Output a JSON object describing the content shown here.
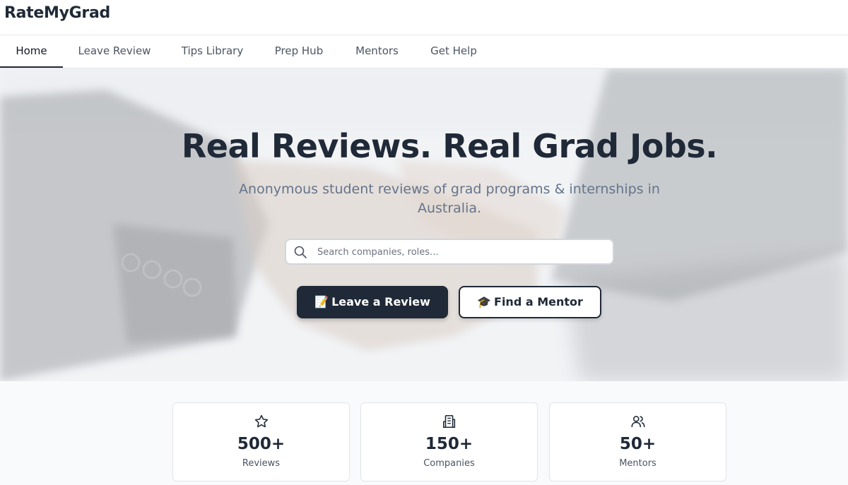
{
  "app": {
    "brand": "RateMyGrad"
  },
  "nav": {
    "tabs": [
      {
        "label": "Home",
        "active": true
      },
      {
        "label": "Leave Review",
        "active": false
      },
      {
        "label": "Tips Library",
        "active": false
      },
      {
        "label": "Prep Hub",
        "active": false
      },
      {
        "label": "Mentors",
        "active": false
      },
      {
        "label": "Get Help",
        "active": false
      }
    ]
  },
  "hero": {
    "title": "Real Reviews. Real Grad Jobs.",
    "subtitle": "Anonymous student reviews of grad programs & internships in Australia.",
    "search": {
      "placeholder": "Search companies, roles...",
      "value": "",
      "icon": "search-icon"
    },
    "primary_button": {
      "emoji": "📝",
      "label": "Leave a Review"
    },
    "secondary_button": {
      "emoji": "🎓",
      "label": "Find a Mentor"
    }
  },
  "stats": [
    {
      "icon": "star-icon",
      "value": "500+",
      "label": "Reviews"
    },
    {
      "icon": "building-icon",
      "value": "150+",
      "label": "Companies"
    },
    {
      "icon": "users-icon",
      "value": "50+",
      "label": "Mentors"
    }
  ],
  "colors": {
    "accent": "#1f2937",
    "muted": "#64748b",
    "background": "#f8fafc"
  }
}
